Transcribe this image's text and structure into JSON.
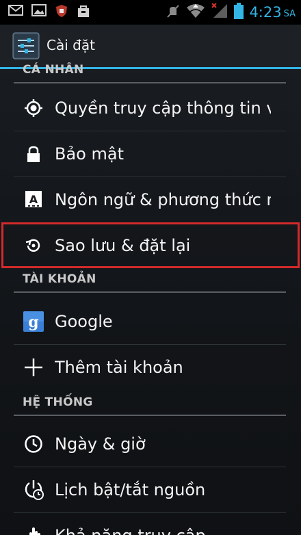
{
  "status_bar": {
    "time": "4:23",
    "ampm": "SA",
    "accent_color": "#33b5e5",
    "icons_left": [
      "gmail-icon",
      "gallery-icon",
      "shield-app-icon",
      "store-bag-icon"
    ],
    "icons_right": [
      "mute-icon",
      "wifi-icon",
      "signal-no-service-icon",
      "battery-icon"
    ]
  },
  "action_bar": {
    "title": "Cài đặt",
    "icon": "settings-sliders-icon"
  },
  "sections": {
    "personal": "CÁ NHÂN",
    "accounts": "TÀI KHOẢN",
    "system": "HỆ THỐNG"
  },
  "items": {
    "location": {
      "label": "Quyền truy cập thông tin vị trí",
      "icon": "location-target-icon"
    },
    "security": {
      "label": "Bảo mật",
      "icon": "lock-icon"
    },
    "language": {
      "label": "Ngôn ngữ & phương thức nhập",
      "icon": "keyboard-a-icon"
    },
    "backup": {
      "label": "Sao lưu & đặt lại",
      "icon": "backup-restore-icon"
    },
    "google": {
      "label": "Google",
      "icon": "google-g-icon"
    },
    "add_account": {
      "label": "Thêm tài khoản",
      "icon": "plus-icon"
    },
    "date_time": {
      "label": "Ngày & giờ",
      "icon": "clock-icon"
    },
    "power_schedule": {
      "label": "Lịch bật/tắt nguồn",
      "icon": "power-clock-icon"
    },
    "accessibility": {
      "label": "Khả năng truy cập",
      "icon": "hand-icon"
    }
  }
}
